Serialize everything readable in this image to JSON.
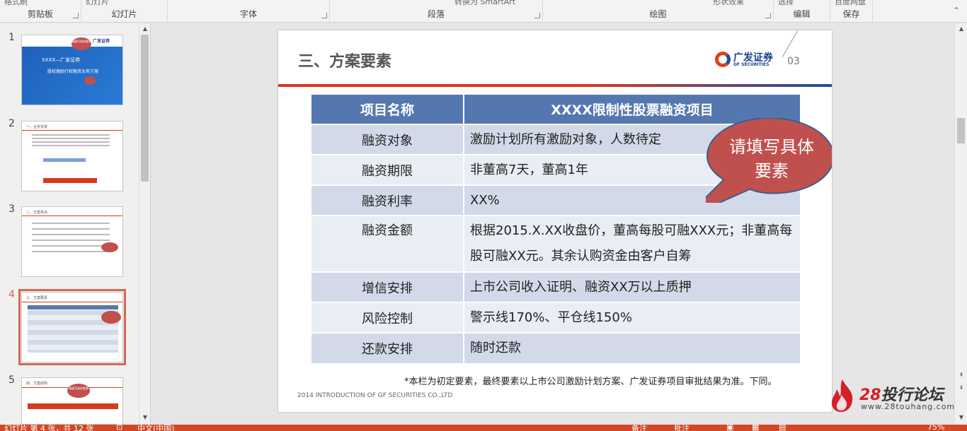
{
  "ribbon": {
    "groups": [
      {
        "label": "剪贴板",
        "top_text": "格式刷"
      },
      {
        "label": "幻灯片",
        "top_text": "幻灯片"
      },
      {
        "label": "字体",
        "top_text": ""
      },
      {
        "label": "段落",
        "top_text": "转换为 SmartArt"
      },
      {
        "label": "绘图",
        "top_text": "形状效果"
      },
      {
        "label": "编辑",
        "top_text": "选择"
      },
      {
        "label": "保存",
        "top_text": "百度网盘"
      }
    ]
  },
  "thumbnails": {
    "numbers": [
      "1",
      "2",
      "3",
      "4",
      "5"
    ],
    "selected": "4",
    "t1": {
      "title": "XXXX—广发证券",
      "subtitle": "股权激励行权融资业务方案",
      "bubble": "请填写具体要素"
    },
    "t2": {
      "title": "一、业务背景"
    },
    "t3": {
      "title": "二、方案亮点"
    },
    "t4": {
      "title": "三、方案要素"
    },
    "t5": {
      "title": "四、方案结构",
      "bubble": "请填写具体要素"
    }
  },
  "slide": {
    "title": "三、方案要素",
    "logo_cn": "广发证券",
    "logo_en": "GF SECURITIES",
    "page_number": "03",
    "table": {
      "headers": [
        "项目名称",
        "XXXX限制性股票融资项目"
      ],
      "rows": [
        {
          "name": "融资对象",
          "value": "激励计划所有激励对象，人数待定"
        },
        {
          "name": "融资期限",
          "value": "非董高7天，董高1年"
        },
        {
          "name": "融资利率",
          "value": "XX%"
        },
        {
          "name": "融资金额",
          "value": "根据2015.X.XX收盘价，董高每股可融XXX元；非董高每股可融XX元。其余认购资金由客户自筹"
        },
        {
          "name": "增信安排",
          "value": "上市公司收入证明、融资XX万以上质押"
        },
        {
          "name": "风险控制",
          "value": "警示线170%、平仓线150%"
        },
        {
          "name": "还款安排",
          "value": "随时还款"
        }
      ]
    },
    "bubble": "请填写具体要素",
    "footnote": "*本栏为初定要素，最终要素以上市公司激励计划方案、广发证券项目审批结果为准。下同。",
    "footer": "2014 INTRODUCTION OF GF SECURITIES CO.,LTD"
  },
  "watermark": {
    "brand_num": "28",
    "brand_text": "投行论坛",
    "url": "www.28touhang.com"
  },
  "statusbar": {
    "slide_info": "幻灯片 第 4 张，共 12 张",
    "language": "中文(中国)",
    "notes": "备注",
    "comments": "批注",
    "zoom": "75%"
  },
  "colors": {
    "accent": "#d24726",
    "table_header": "#5577b0",
    "bubble": "#c0504d"
  }
}
